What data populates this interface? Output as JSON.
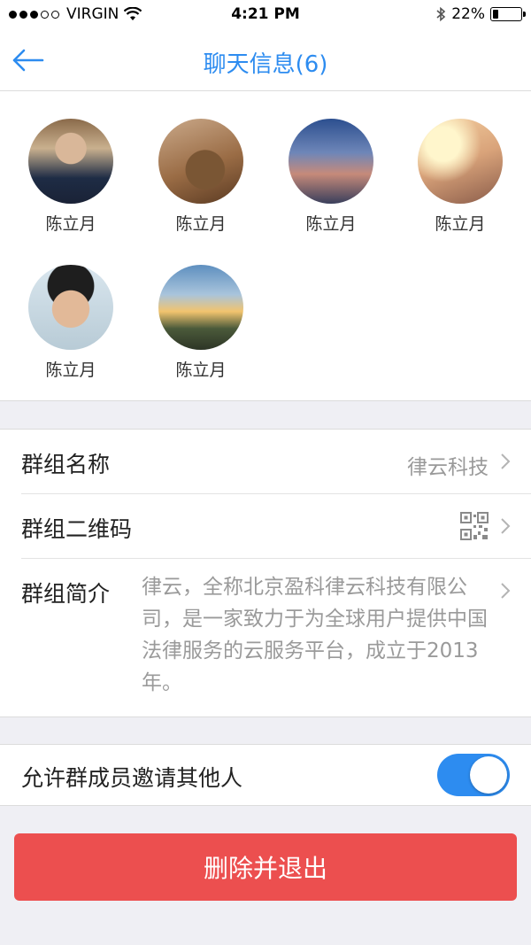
{
  "status_bar": {
    "carrier": "VIRGIN",
    "time": "4:21 PM",
    "battery": "22%",
    "battery_level": 0.22,
    "signal_bars_filled": 3,
    "signal_bars_total": 5
  },
  "nav": {
    "title": "聊天信息(6)",
    "back_icon": "back-arrow-icon",
    "accent_color": "#2d8cf0"
  },
  "members": [
    {
      "name": "陈立月",
      "avatar": "avatar-man-suit"
    },
    {
      "name": "陈立月",
      "avatar": "avatar-deer"
    },
    {
      "name": "陈立月",
      "avatar": "avatar-city"
    },
    {
      "name": "陈立月",
      "avatar": "avatar-woman-sunset"
    },
    {
      "name": "陈立月",
      "avatar": "avatar-young-man"
    },
    {
      "name": "陈立月",
      "avatar": "avatar-landscape"
    }
  ],
  "settings": {
    "group_name": {
      "label": "群组名称",
      "value": "律云科技"
    },
    "group_qrcode": {
      "label": "群组二维码",
      "icon": "qrcode-icon"
    },
    "group_intro": {
      "label": "群组简介",
      "value": "律云，全称北京盈科律云科技有限公司，是一家致力于为全球用户提供中国法律服务的云服务平台，成立于2013年。"
    }
  },
  "invite_setting": {
    "label": "允许群成员邀请其他人",
    "enabled": true
  },
  "exit_button": {
    "label": "删除并退出",
    "color": "#ec4f4f"
  }
}
